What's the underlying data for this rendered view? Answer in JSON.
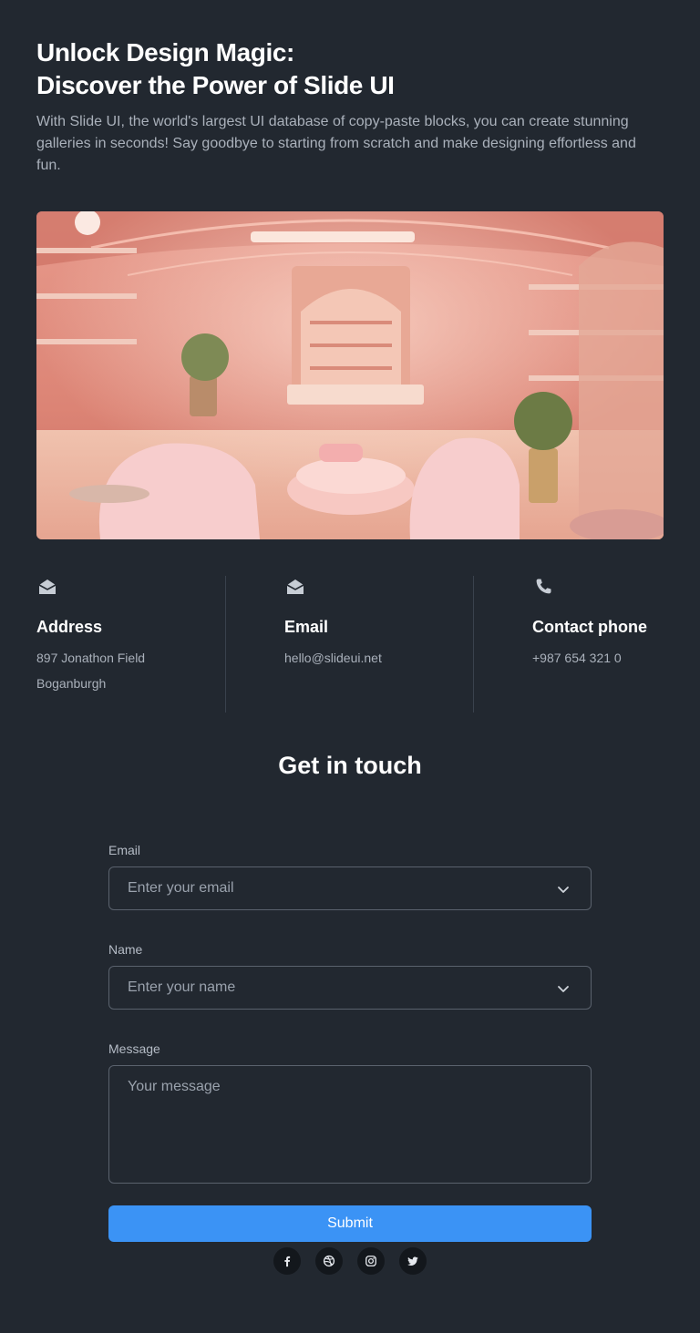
{
  "hero": {
    "title_line1": "Unlock Design Magic:",
    "title_line2": "Discover the Power of Slide UI",
    "description": "With Slide UI, the world's largest UI database of copy-paste blocks, you can create stunning galleries in seconds! Say goodbye to starting from scratch and make designing effortless and fun."
  },
  "contacts": [
    {
      "icon": "envelope-open-icon",
      "title": "Address",
      "lines": [
        "897 Jonathon Field",
        "Boganburgh"
      ]
    },
    {
      "icon": "envelope-open-icon",
      "title": "Email",
      "lines": [
        "hello@slideui.net"
      ]
    },
    {
      "icon": "phone-icon",
      "title": "Contact phone",
      "lines": [
        "+987 654 321 0"
      ]
    }
  ],
  "form": {
    "title": "Get in touch",
    "email": {
      "label": "Email",
      "placeholder": "Enter your email"
    },
    "name": {
      "label": "Name",
      "placeholder": "Enter your name"
    },
    "message": {
      "label": "Message",
      "placeholder": "Your message"
    },
    "submit_label": "Submit"
  },
  "socials": [
    "facebook-icon",
    "dribbble-icon",
    "instagram-icon",
    "twitter-icon"
  ],
  "colors": {
    "background": "#222830",
    "accent": "#3b93f5",
    "muted_text": "#aab1bb"
  }
}
